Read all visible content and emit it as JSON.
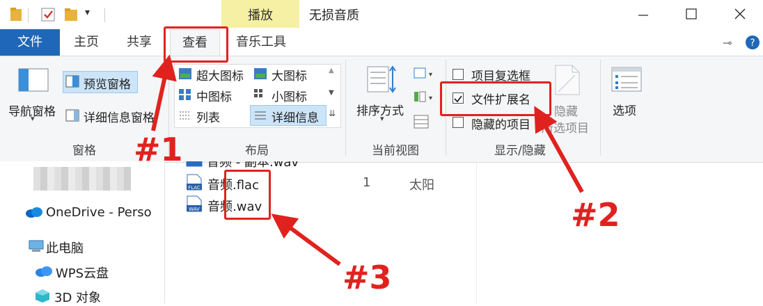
{
  "window": {
    "context_tab": "播放",
    "title": "无损音质"
  },
  "tabs": [
    "文件",
    "主页",
    "共享",
    "查看",
    "音乐工具"
  ],
  "ribbon": {
    "pane": {
      "nav_pane": "导航窗格",
      "preview_pane": "预览窗格",
      "details_pane": "详细信息窗格",
      "label": "窗格"
    },
    "layout": {
      "items": [
        "超大图标",
        "大图标",
        "中图标",
        "小图标",
        "列表",
        "详细信息"
      ],
      "label": "布局"
    },
    "current_view": {
      "sort": "排序方式",
      "label": "当前视图"
    },
    "show_hide": {
      "item_checkboxes": "项目复选框",
      "file_extensions": "文件扩展名",
      "hidden_items": "隐藏的项目",
      "hide_selected_1": "隐藏",
      "hide_selected_2": "所选项目",
      "label": "显示/隐藏",
      "checked": {
        "item_checkboxes": false,
        "file_extensions": true,
        "hidden_items": false
      }
    },
    "options": "选项"
  },
  "nav": {
    "onedrive": "OneDrive - Perso",
    "this_pc": "此电脑",
    "wps": "WPS云盘",
    "objects3d": "3D 对象"
  },
  "files": [
    {
      "name": "音频 - 副本.wav",
      "icon": "WAV"
    },
    {
      "name": "音频.flac",
      "icon": "FLAC",
      "number": "1",
      "artist": "太阳"
    },
    {
      "name": "音频.wav",
      "icon": "WAV"
    }
  ],
  "annotations": [
    "#1",
    "#2",
    "#3"
  ],
  "colors": {
    "accent": "#1f67b8",
    "annotation": "#e0221f",
    "context_tab": "#f6f0a4"
  }
}
